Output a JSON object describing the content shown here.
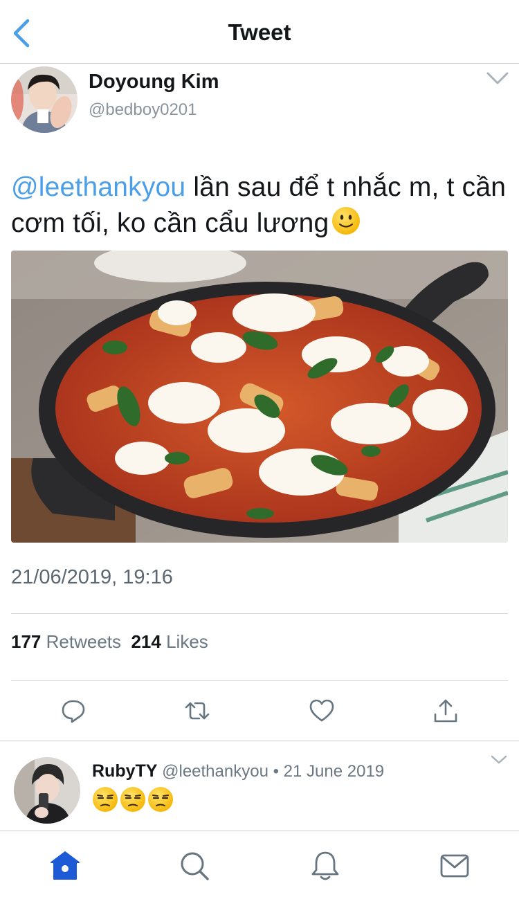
{
  "header": {
    "title": "Tweet",
    "back_icon": "chevron-left-icon"
  },
  "author": {
    "name": "Doyoung Kim",
    "handle": "@bedboy0201"
  },
  "tweet": {
    "mention": "@leethankyou",
    "text": " lần sau để t nhắc m, t cần cơm tối, ko cần cẩu lương",
    "emoji": "slightly-smiling-face",
    "photo": "baked-pasta-skillet",
    "timestamp": "21/06/2019, 19:16"
  },
  "stats": {
    "retweets_count": "177",
    "retweets_label": "Retweets",
    "likes_count": "214",
    "likes_label": "Likes"
  },
  "actions": [
    "reply-icon",
    "retweet-icon",
    "like-icon",
    "share-icon"
  ],
  "reply": {
    "name": "RubyTY",
    "handle": "@leethankyou",
    "separator": "•",
    "date": "21 June 2019",
    "emojis": [
      "unamused-face",
      "unamused-face",
      "unamused-face"
    ]
  },
  "tabbar": [
    "home-icon",
    "search-icon",
    "notifications-icon",
    "messages-icon"
  ],
  "colors": {
    "link": "#4a9fe8",
    "accent": "#1d5bd6",
    "icon_gray": "#66757f",
    "divider": "#c8ccd0"
  }
}
